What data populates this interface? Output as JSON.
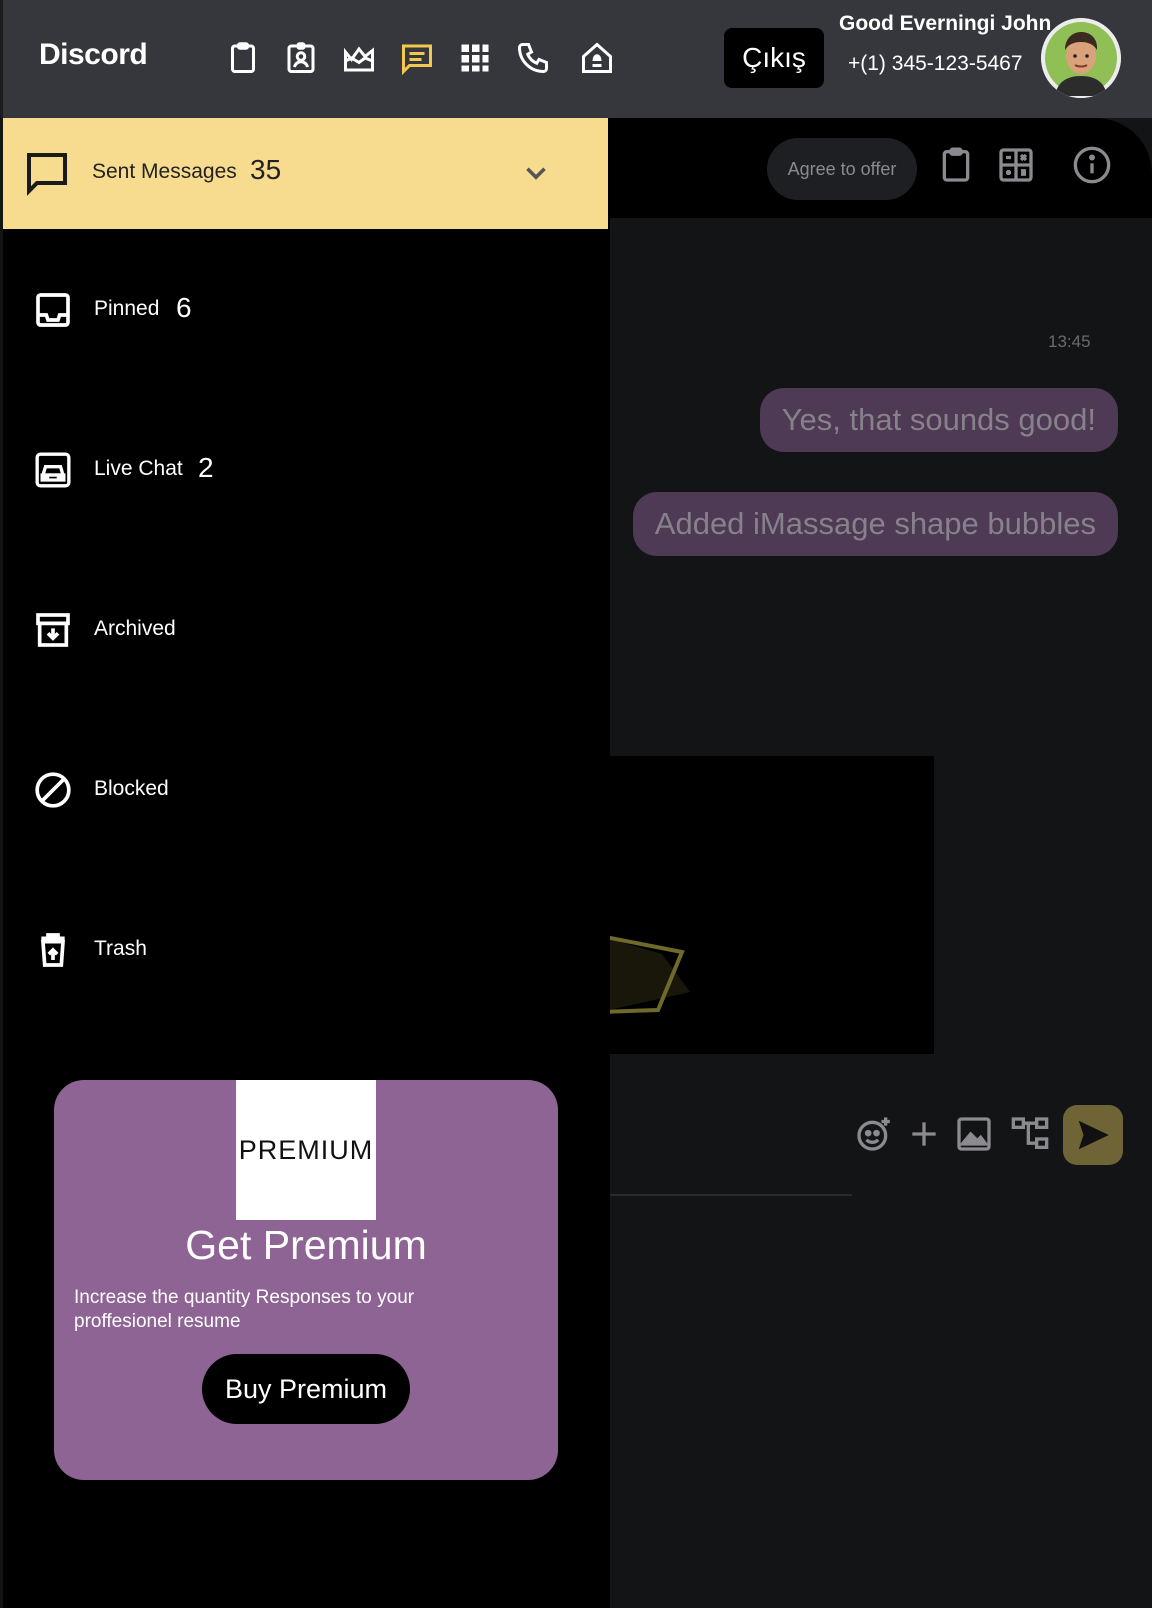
{
  "app": {
    "brand": "Discord"
  },
  "topbar": {
    "nav_icons": [
      "clipboard-icon",
      "contact-badge-icon",
      "landscape-icon",
      "chat-icon",
      "apps-grid-icon",
      "phone-icon",
      "home-alert-icon"
    ],
    "active_nav": "chat-icon",
    "logout_label": "Çıkış",
    "greeting": "Good Everningi John",
    "phone": "+(1) 345-123-5467"
  },
  "sidebar": {
    "sent": {
      "label": "Sent Messages",
      "count": "35",
      "icon": "message-icon"
    },
    "items": [
      {
        "label": "Pinned",
        "count": "6",
        "icon": "inbox-icon"
      },
      {
        "label": "Live Chat",
        "count": "2",
        "icon": "car-icon"
      },
      {
        "label": "Archived",
        "count": "",
        "icon": "archive-icon"
      },
      {
        "label": "Blocked",
        "count": "",
        "icon": "block-icon"
      },
      {
        "label": "Trash",
        "count": "",
        "icon": "trash-icon"
      }
    ]
  },
  "premium": {
    "logo_text": "PREMIUM",
    "title": "Get Premium",
    "description": "Increase the quantity Responses to your proffesionel resume",
    "button": "Buy Premium"
  },
  "chat": {
    "agree_label": "Agree to offer",
    "timestamp": "13:45",
    "messages": [
      "Yes, that sounds good!",
      "Added iMassage shape bubbles"
    ]
  },
  "colors": {
    "accent": "#f7dc8f",
    "bubble": "#4f3a55",
    "premium": "#8e6494",
    "topbar": "#36373d",
    "send": "#6f6435"
  }
}
